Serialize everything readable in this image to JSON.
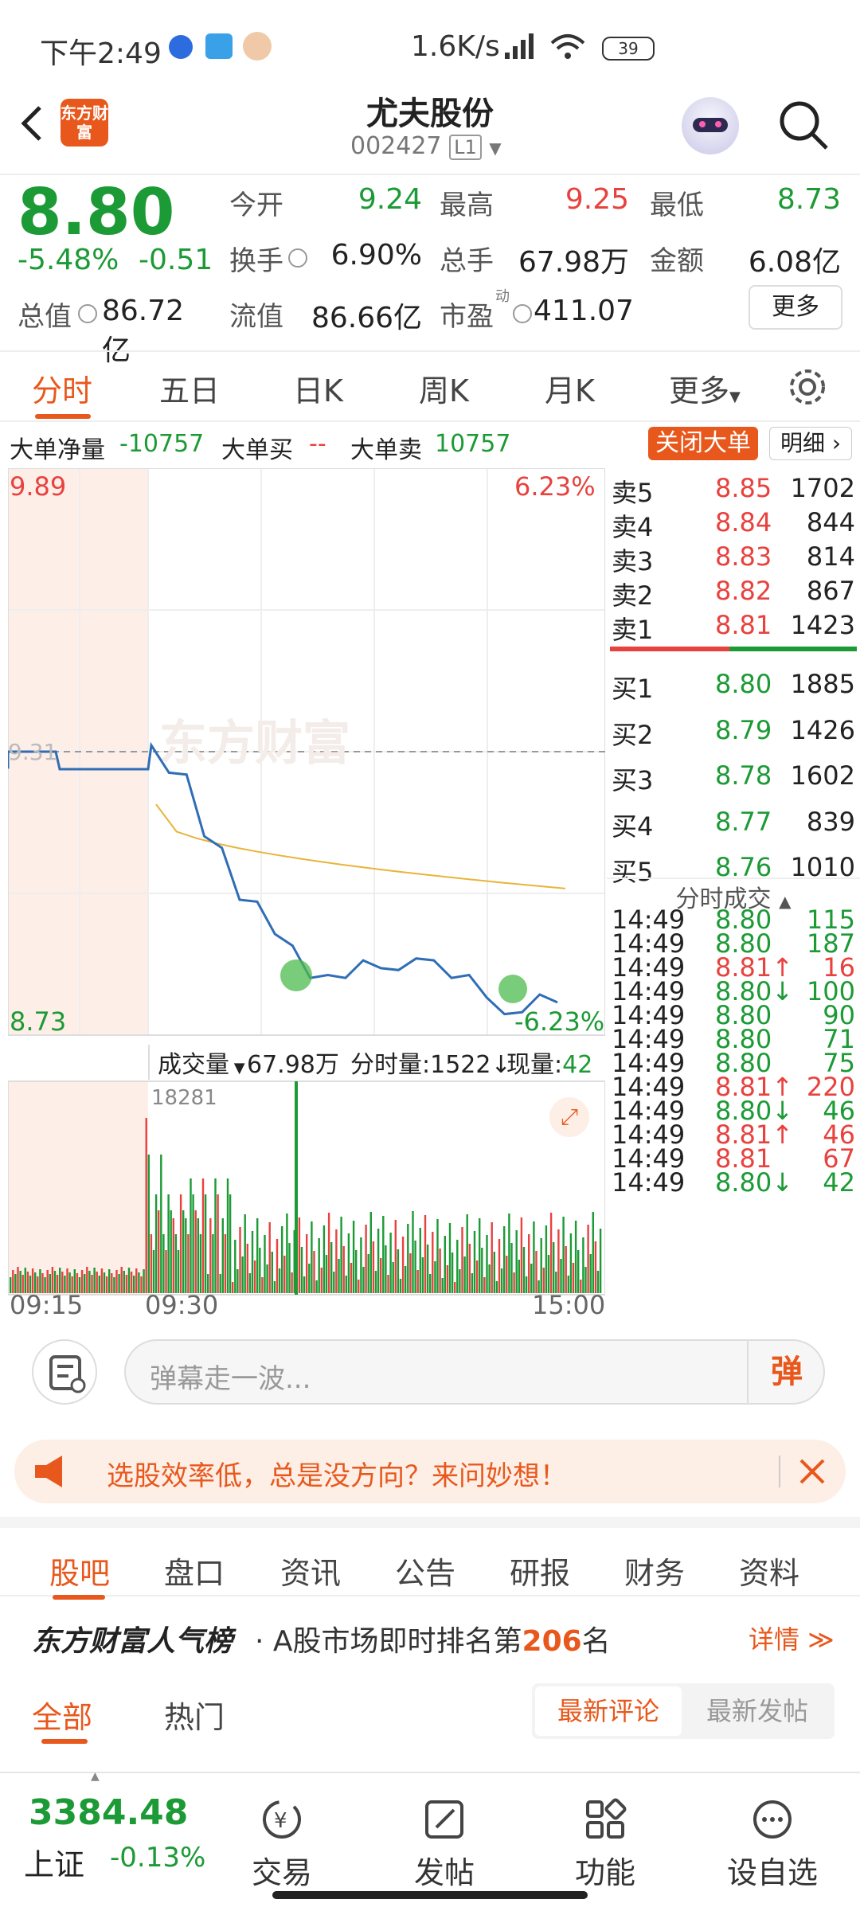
{
  "status_bar": {
    "time": "下午2:49",
    "network_speed": "1.6K/s",
    "battery": "39"
  },
  "header": {
    "stock_name": "尤夫股份",
    "stock_code": "002427",
    "level": "L1",
    "logo_text": "东方财富"
  },
  "quote": {
    "price": "8.80",
    "change_pct": "-5.48%",
    "change": "-0.51",
    "open_label": "今开",
    "open": "9.24",
    "high_label": "最高",
    "high": "9.25",
    "low_label": "最低",
    "low": "8.73",
    "turnover_label": "换手",
    "turnover": "6.90%",
    "volume_label": "总手",
    "volume": "67.98万",
    "amount_label": "金额",
    "amount": "6.08亿",
    "mktcap_label": "总值",
    "mktcap": "86.72亿",
    "float_label": "流值",
    "float_cap": "86.66亿",
    "pe_label": "市盈",
    "pe_sup": "动",
    "pe": "411.07",
    "more_label": "更多"
  },
  "kline_tabs": [
    "分时",
    "五日",
    "日K",
    "周K",
    "月K",
    "更多"
  ],
  "big_order": {
    "net_label": "大单净量",
    "net": "-10757",
    "buy_label": "大单买",
    "buy": "--",
    "sell_label": "大单卖",
    "sell": "10757",
    "close_btn": "关闭大单",
    "detail_btn": "明细"
  },
  "chart": {
    "top_price": "9.89",
    "top_pct": "6.23%",
    "bottom_price": "8.73",
    "bottom_pct": "-6.23%",
    "ref_price": "9.31",
    "watermark": "东方财富",
    "volume_label": "成交量",
    "volume_total": "67.98万",
    "min_vol_label": "分时量:1522↓",
    "current_label": "现量:",
    "current_vol": "42",
    "max_vol": "18281",
    "time_start": "09:15",
    "time_mid": "09:30",
    "time_end": "15:00",
    "colors": {
      "price_line": "#2f6db5",
      "avg_line": "#e8b43a",
      "up": "#e8423f",
      "down": "#1c9a35"
    }
  },
  "chart_data": {
    "type": "line",
    "series": [
      {
        "values": [
          9.31,
          9.28,
          9.25,
          9.15,
          9.1,
          9.02,
          8.99,
          8.95,
          8.9,
          8.86,
          8.84,
          8.86,
          8.87,
          8.88,
          8.85,
          8.9,
          8.87,
          8.86,
          8.84,
          8.82,
          8.76,
          8.79,
          8.8,
          8.81
        ]
      }
    ],
    "ylim": [
      8.73,
      9.89
    ]
  },
  "order_book": {
    "asks": [
      {
        "label": "卖5",
        "price": "8.85",
        "vol": "1702"
      },
      {
        "label": "卖4",
        "price": "8.84",
        "vol": "844"
      },
      {
        "label": "卖3",
        "price": "8.83",
        "vol": "814"
      },
      {
        "label": "卖2",
        "price": "8.82",
        "vol": "867"
      },
      {
        "label": "卖1",
        "price": "8.81",
        "vol": "1423"
      }
    ],
    "bids": [
      {
        "label": "买1",
        "price": "8.80",
        "vol": "1885"
      },
      {
        "label": "买2",
        "price": "8.79",
        "vol": "1426"
      },
      {
        "label": "买3",
        "price": "8.78",
        "vol": "1602"
      },
      {
        "label": "买4",
        "price": "8.77",
        "vol": "839"
      },
      {
        "label": "买5",
        "price": "8.76",
        "vol": "1010"
      }
    ],
    "trades_title": "分时成交",
    "trades": [
      {
        "t": "14:49",
        "p": "8.80",
        "v": "115",
        "c": "green"
      },
      {
        "t": "14:49",
        "p": "8.80",
        "v": "187",
        "c": "green"
      },
      {
        "t": "14:49",
        "p": "8.81↑",
        "v": "16",
        "c": "red"
      },
      {
        "t": "14:49",
        "p": "8.80↓",
        "v": "100",
        "c": "green"
      },
      {
        "t": "14:49",
        "p": "8.80",
        "v": "90",
        "c": "green"
      },
      {
        "t": "14:49",
        "p": "8.80",
        "v": "71",
        "c": "green"
      },
      {
        "t": "14:49",
        "p": "8.80",
        "v": "75",
        "c": "green"
      },
      {
        "t": "14:49",
        "p": "8.81↑",
        "v": "220",
        "c": "red"
      },
      {
        "t": "14:49",
        "p": "8.80↓",
        "v": "46",
        "c": "green"
      },
      {
        "t": "14:49",
        "p": "8.81↑",
        "v": "46",
        "c": "red"
      },
      {
        "t": "14:49",
        "p": "8.81",
        "v": "67",
        "c": "red"
      },
      {
        "t": "14:49",
        "p": "8.80↓",
        "v": "42",
        "c": "green"
      }
    ]
  },
  "danmu": {
    "placeholder": "弹幕走一波...",
    "send_label": "弹"
  },
  "banner": {
    "text": "选股效率低，总是没方向？来问妙想！"
  },
  "lower_tabs": [
    "股吧",
    "盘口",
    "资讯",
    "公告",
    "研报",
    "财务",
    "资料"
  ],
  "ranking": {
    "brand": "东方财富人气榜",
    "prefix": "· A股市场即时排名第",
    "rank": "206",
    "suffix": "名",
    "detail": "详情"
  },
  "feed_tabs": {
    "all": "全部",
    "hot": "热门",
    "latest_comment": "最新评论",
    "latest_post": "最新发帖"
  },
  "bottom_bar": {
    "index_value": "3384.48",
    "index_name": "上证",
    "index_change": "-0.13%",
    "items": [
      "交易",
      "发帖",
      "功能",
      "设自选"
    ]
  }
}
